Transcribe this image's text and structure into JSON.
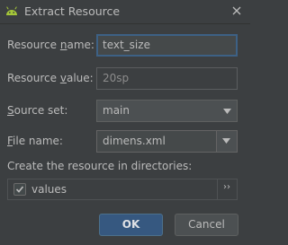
{
  "window": {
    "title": "Extract Resource",
    "app_icon": "android-icon",
    "close_icon": "close-icon"
  },
  "form": {
    "resource_name": {
      "label_pre": "Resource ",
      "label_mnemonic": "n",
      "label_post": "ame:",
      "value": "text_size"
    },
    "resource_value": {
      "label_pre": "Resource ",
      "label_mnemonic": "v",
      "label_post": "alue:",
      "value": "20sp"
    },
    "source_set": {
      "label_pre": "",
      "label_mnemonic": "S",
      "label_post": "ource set:",
      "value": "main"
    },
    "file_name": {
      "label_pre": "",
      "label_mnemonic": "F",
      "label_post": "ile name:",
      "value": "dimens.xml"
    },
    "directories_label": "Create the resource in directories:",
    "directories": [
      {
        "name": "values",
        "checked": true
      }
    ],
    "more_button": "››"
  },
  "buttons": {
    "ok": "OK",
    "cancel": "Cancel"
  },
  "colors": {
    "background": "#3c3f41",
    "focus_border": "#3d6185",
    "primary_button": "#365880",
    "android_green": "#a4c639"
  }
}
